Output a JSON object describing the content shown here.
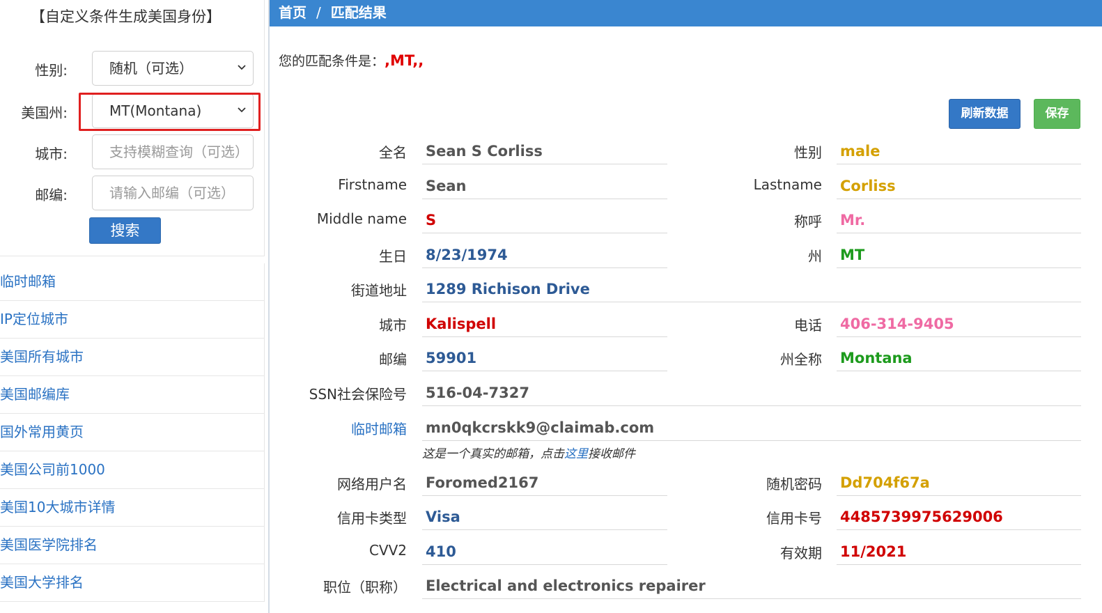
{
  "sidebar": {
    "title": "【自定义条件生成美国身份】",
    "gender_label": "性别:",
    "gender_value": "随机（可选）",
    "state_label": "美国州:",
    "state_value": "MT(Montana)",
    "city_label": "城市:",
    "city_placeholder": "支持模糊查询（可选）",
    "zip_label": "邮编:",
    "zip_placeholder": "请输入邮编（可选）",
    "search_label": "搜索",
    "links": [
      {
        "label": "临时邮箱"
      },
      {
        "label": "IP定位城市"
      },
      {
        "label": "美国所有城市"
      },
      {
        "label": "美国邮编库"
      },
      {
        "label": "国外常用黄页"
      },
      {
        "label": "美国公司前1000"
      },
      {
        "label": "美国10大城市详情"
      },
      {
        "label": "美国医学院排名"
      },
      {
        "label": "美国大学排名"
      }
    ]
  },
  "header": {
    "home": "首页",
    "separator": "/",
    "current": "匹配结果"
  },
  "main": {
    "condition_label": "您的匹配条件是：",
    "condition_value": ",MT,,",
    "refresh_label": "刷新数据",
    "save_label": "保存",
    "note_prefix": "这是一个真实的邮箱，点击",
    "note_link": "这里",
    "note_suffix": "接收邮件",
    "fields": {
      "fullname": {
        "label": "全名",
        "value": "Sean S Corliss"
      },
      "gender": {
        "label": "性别",
        "value": "male"
      },
      "firstname": {
        "label": "Firstname",
        "value": "Sean"
      },
      "lastname": {
        "label": "Lastname",
        "value": "Corliss"
      },
      "middlename": {
        "label": "Middle name",
        "value": "S"
      },
      "title": {
        "label": "称呼",
        "value": "Mr."
      },
      "birthday": {
        "label": "生日",
        "value": "8/23/1974"
      },
      "state": {
        "label": "州",
        "value": "MT"
      },
      "street": {
        "label": "街道地址",
        "value": "1289 Richison Drive"
      },
      "city": {
        "label": "城市",
        "value": "Kalispell"
      },
      "phone": {
        "label": "电话",
        "value": "406-314-9405"
      },
      "zip": {
        "label": "邮编",
        "value": "59901"
      },
      "state_full": {
        "label": "州全称",
        "value": "Montana"
      },
      "ssn": {
        "label": "SSN社会保险号",
        "value": "516-04-7327"
      },
      "email": {
        "label": "临时邮箱",
        "value": "mn0qkcrskk9@claimab.com"
      },
      "username": {
        "label": "网络用户名",
        "value": "Foromed2167"
      },
      "password": {
        "label": "随机密码",
        "value": "Dd704f67a"
      },
      "card_type": {
        "label": "信用卡类型",
        "value": "Visa"
      },
      "card_no": {
        "label": "信用卡号",
        "value": "4485739975629006"
      },
      "cvv2": {
        "label": "CVV2",
        "value": "410"
      },
      "expiry": {
        "label": "有效期",
        "value": "11/2021"
      },
      "job": {
        "label": "职位（职称）",
        "value": "Electrical and electronics repairer"
      }
    }
  },
  "colors": {
    "header_blue": "#3a86d0",
    "button_blue": "#3478c6",
    "button_green": "#5cb85c",
    "highlight_red": "#e02020"
  }
}
